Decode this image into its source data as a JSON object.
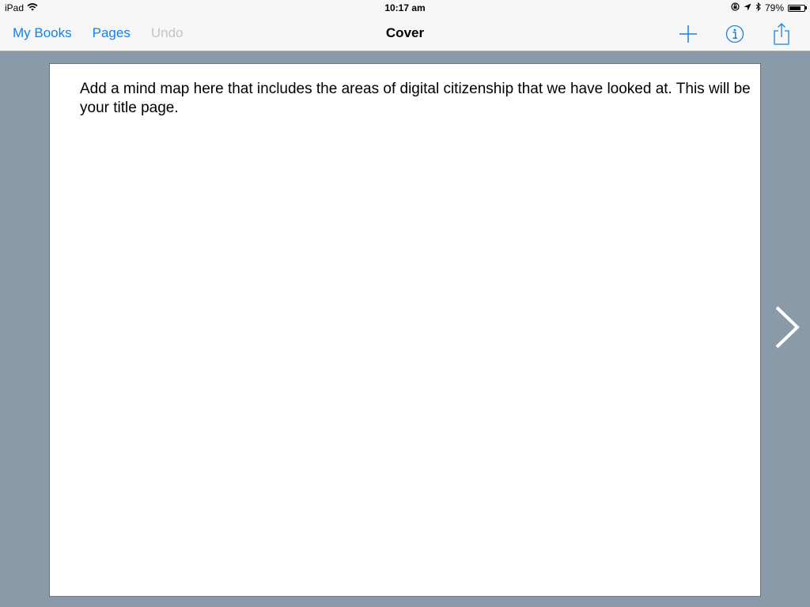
{
  "status_bar": {
    "device": "iPad",
    "time": "10:17 am",
    "battery": "79%",
    "battery_level": 0.79,
    "icons": [
      "wifi-icon",
      "rotation-lock-icon",
      "location-icon",
      "bluetooth-icon",
      "battery-icon"
    ]
  },
  "nav": {
    "my_books": "My Books",
    "pages": "Pages",
    "undo": "Undo",
    "title": "Cover",
    "icons": [
      "plus-icon",
      "info-icon",
      "share-icon"
    ]
  },
  "page": {
    "text": "Add a mind map here that includes the areas of digital citizenship that we have looked at.  This will be your title page."
  },
  "colors": {
    "accent": "#1a7fe0",
    "disabled": "#c4c4c4",
    "background": "#8b9aa8"
  },
  "next_icon": "chevron-right-icon"
}
